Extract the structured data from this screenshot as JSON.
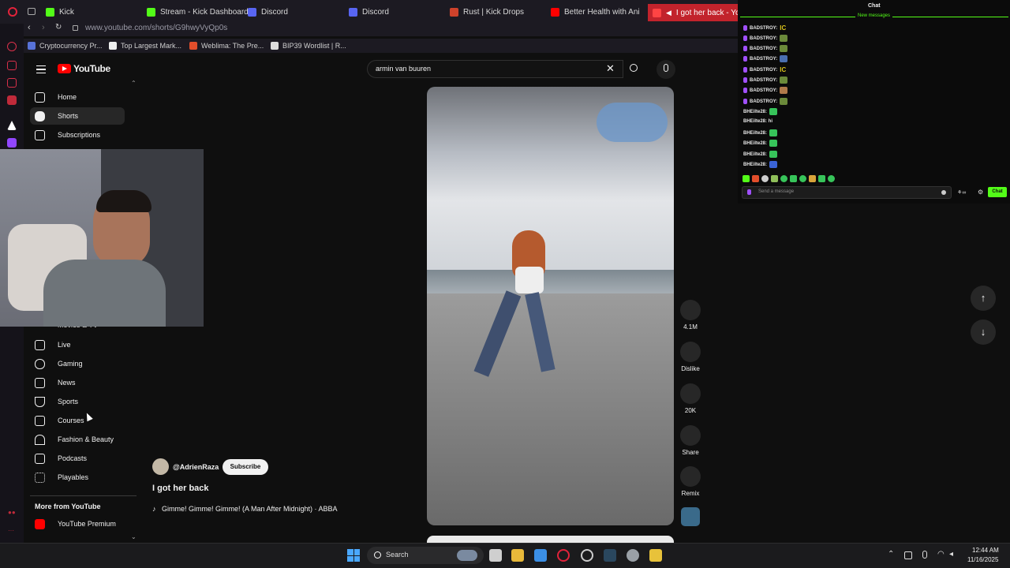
{
  "browser": {
    "tabs": [
      {
        "label": "Kick",
        "color": "#53fc18"
      },
      {
        "label": "Stream - Kick Dashboard",
        "color": "#53fc18"
      },
      {
        "label": "Discord",
        "color": "#5865f2"
      },
      {
        "label": "Discord",
        "color": "#5865f2"
      },
      {
        "label": "Rust | Kick Drops",
        "color": "#ce422b"
      },
      {
        "label": "Better Health with Ani - Y",
        "color": "#ff0000"
      },
      {
        "label": "I got her back - YouT",
        "color": "#ff0000"
      }
    ],
    "url": "www.youtube.com/shorts/G9hwyVyQp0s",
    "bookmarks": [
      "Cryptocurrency Pr...",
      "Top Largest Mark...",
      "Weblima: The Pre...",
      "BIP39 Wordlist | R..."
    ]
  },
  "youtube": {
    "logo": "YouTube",
    "search_value": "armin van buuren",
    "nav_top": [
      {
        "label": "Home",
        "icon": "home-icon"
      },
      {
        "label": "Shorts",
        "icon": "shorts-icon"
      },
      {
        "label": "Subscriptions",
        "icon": "subscriptions-icon"
      }
    ],
    "nav_partial": "Movies & TV",
    "nav_explore": [
      {
        "label": "Live",
        "icon": "live-icon"
      },
      {
        "label": "Gaming",
        "icon": "gaming-icon"
      },
      {
        "label": "News",
        "icon": "news-icon"
      },
      {
        "label": "Sports",
        "icon": "trophy-icon"
      },
      {
        "label": "Courses",
        "icon": "courses-icon"
      },
      {
        "label": "Fashion & Beauty",
        "icon": "hanger-icon"
      },
      {
        "label": "Podcasts",
        "icon": "podcast-icon"
      },
      {
        "label": "Playables",
        "icon": "playables-icon"
      }
    ],
    "more_heading": "More from YouTube",
    "more_items": [
      {
        "label": "YouTube Premium",
        "icon": "youtube-premium-icon"
      }
    ],
    "short": {
      "channel": "@AdrienRaza",
      "subscribe": "Subscribe",
      "title": "I got her back",
      "music": "Gimme! Gimme! Gimme! (A Man After Midnight) · ABBA"
    },
    "actions": [
      {
        "label": "4.1M",
        "icon": "like-icon"
      },
      {
        "label": "Dislike",
        "icon": "dislike-icon"
      },
      {
        "label": "20K",
        "icon": "comment-icon"
      },
      {
        "label": "Share",
        "icon": "share-icon"
      },
      {
        "label": "Remix",
        "icon": "remix-icon"
      }
    ]
  },
  "chat": {
    "title": "Chat",
    "new_messages": "New messages",
    "messages": [
      {
        "user": "BADSTROY:",
        "emote": "IC",
        "color": "#d9c21b"
      },
      {
        "user": "BADSTROY:",
        "emote": "",
        "color": "#6b8a3a"
      },
      {
        "user": "BADSTROY:",
        "emote": "",
        "color": "#6b8a3a"
      },
      {
        "user": "BADSTROY:",
        "emote": "",
        "color": "#4a6fb0"
      },
      {
        "user": "BADSTROY:",
        "emote": "IC",
        "color": "#d9c21b"
      },
      {
        "user": "BADSTROY:",
        "emote": "",
        "color": "#6b8a3a"
      },
      {
        "user": "BADSTROY:",
        "emote": "",
        "color": "#b07a4a"
      },
      {
        "user": "BADSTROY:",
        "emote": "",
        "color": "#6b8a3a"
      },
      {
        "user": "BHEilte28:",
        "emote": "",
        "color": "#37c45a"
      },
      {
        "user": "BHEilte28: hi",
        "emote": "",
        "color": ""
      },
      {
        "user": "BHEilte28:",
        "emote": "",
        "color": "#37c45a"
      },
      {
        "user": "BHEilte28:",
        "emote": "",
        "color": "#37c45a"
      },
      {
        "user": "BHEilte28:",
        "emote": "",
        "color": "#37c45a"
      },
      {
        "user": "BHEilte28:",
        "emote": "",
        "color": "#3a63d6"
      }
    ],
    "input_placeholder": "Send a message",
    "send_label": "Chat"
  },
  "taskbar": {
    "search_label": "Search",
    "time": "12:44 AM",
    "date": "11/16/2025"
  }
}
